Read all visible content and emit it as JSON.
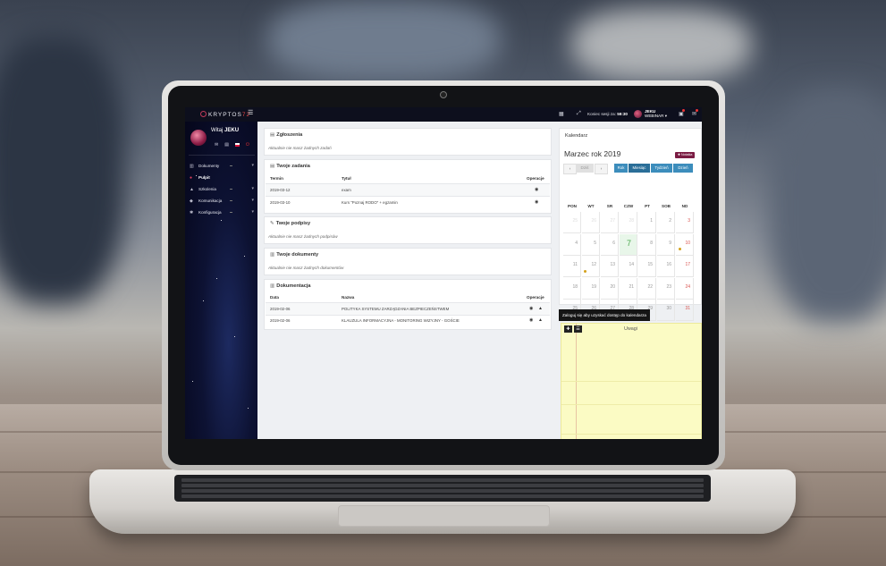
{
  "app": {
    "logo_text": "KRYPTOS",
    "logo_version": "72",
    "session_label": "Koniec sesji za:",
    "session_time": "59:30",
    "user_name": "JEKU",
    "user_role": "WEBINAR"
  },
  "sidebar": {
    "welcome_prefix": "Witaj",
    "welcome_name": "JEKU",
    "items": [
      {
        "label": "Dokumenty",
        "icon": "book-icon",
        "active": false
      },
      {
        "label": "Pulpit",
        "icon": "dashboard-icon",
        "active": true
      },
      {
        "label": "Szkolenia",
        "icon": "graduation-cap-icon",
        "active": false
      },
      {
        "label": "Komunikacja",
        "icon": "chat-icon",
        "active": false
      },
      {
        "label": "Konfiguracja",
        "icon": "gear-icon",
        "active": false
      }
    ]
  },
  "zgloszenia": {
    "title": "Zgłoszenia",
    "empty": "Aktualnie nie masz żadnych zadań"
  },
  "zadania": {
    "title": "Twoje zadania",
    "headers": [
      "Termin",
      "Tytuł",
      "Operacje"
    ],
    "rows": [
      {
        "date": "2019-03-12",
        "title": "exam"
      },
      {
        "date": "2019-03-10",
        "title": "Kurs \"Poznaj RODO\" + egzamin"
      }
    ]
  },
  "podpisy": {
    "title": "Twoje podpisy",
    "empty": "Aktualnie nie masz żadnych podpisów"
  },
  "dokumenty": {
    "title": "Twoje dokumenty",
    "empty": "Aktualnie nie masz żadnych dokumentów"
  },
  "dokumentacja": {
    "title": "Dokumentacja",
    "headers": [
      "Data",
      "Nazwa",
      "Operacje"
    ],
    "rows": [
      {
        "date": "2019-02-06",
        "name": "POLITYKA SYSTEMU ZARZĄDZANIA BEZPIECZEŃSTWEM"
      },
      {
        "date": "2019-02-06",
        "name": "KLAUZULA INFORMACYJNA - MONITORING WIZYJNY - GOŚCIE"
      }
    ]
  },
  "calendar": {
    "title": "Kalendarz",
    "month_label": "Marzec rok 2019",
    "note_button": "Notatka",
    "today_button": "Dziś",
    "views": [
      "Rok",
      "Miesiąc",
      "Tydzień",
      "Dzień"
    ],
    "active_view": "Miesiąc",
    "weekdays": [
      "PON",
      "WT",
      "SR",
      "CZW",
      "PT",
      "SOB",
      "ND"
    ],
    "weeks": [
      [
        "25",
        "26",
        "27",
        "28",
        "1",
        "2",
        "3"
      ],
      [
        "4",
        "5",
        "6",
        "7",
        "8",
        "9",
        "10"
      ],
      [
        "11",
        "12",
        "13",
        "14",
        "15",
        "16",
        "17"
      ],
      [
        "18",
        "19",
        "20",
        "21",
        "22",
        "23",
        "24"
      ],
      [
        "25",
        "26",
        "27",
        "28",
        "29",
        "30",
        "31"
      ]
    ],
    "today": "7",
    "tooltip": "Zaloguj się aby uzyskać dostęp do kalendarza"
  },
  "notes": {
    "title": "Uwagi"
  },
  "colors": {
    "accent": "#3c8dbc",
    "note_button": "#7b1c43",
    "today_bg": "#e8f6e9",
    "event_dot": "#d4a11c",
    "notes_bg": "#fbfbc4"
  }
}
